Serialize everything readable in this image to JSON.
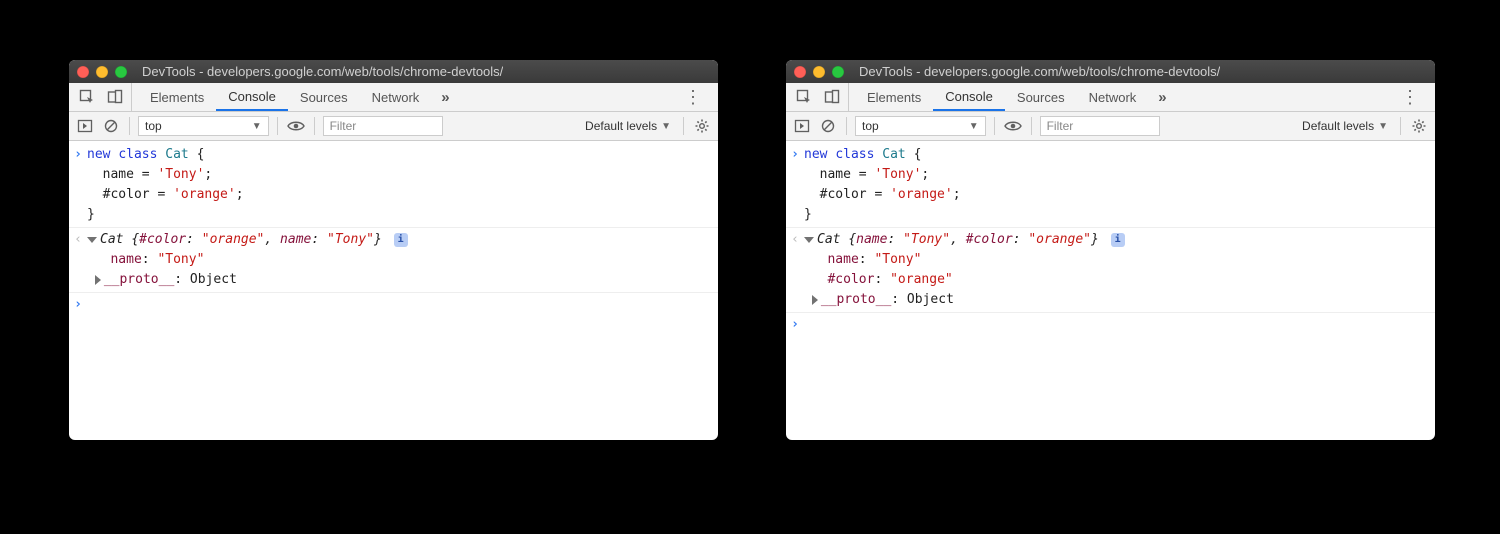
{
  "windows": [
    {
      "title": "DevTools - developers.google.com/web/tools/chrome-devtools/",
      "tabs": [
        "Elements",
        "Console",
        "Sources",
        "Network"
      ],
      "active_tab": "Console",
      "more_tabs_glyph": "»",
      "toolbar": {
        "context": "top",
        "filter_placeholder": "Filter",
        "levels": "Default levels"
      },
      "input_code": "new class Cat {\n  name = 'Tony';\n  #color = 'orange';\n}",
      "result": {
        "header_prefix": "Cat ",
        "header_body": "{#color: \"orange\", name: \"Tony\"}",
        "props": [
          {
            "key": "name",
            "value": "\"Tony\"",
            "is_string": true
          }
        ],
        "proto": {
          "key": "__proto__",
          "value": "Object"
        }
      }
    },
    {
      "title": "DevTools - developers.google.com/web/tools/chrome-devtools/",
      "tabs": [
        "Elements",
        "Console",
        "Sources",
        "Network"
      ],
      "active_tab": "Console",
      "more_tabs_glyph": "»",
      "toolbar": {
        "context": "top",
        "filter_placeholder": "Filter",
        "levels": "Default levels"
      },
      "input_code": "new class Cat {\n  name = 'Tony';\n  #color = 'orange';\n}",
      "result": {
        "header_prefix": "Cat ",
        "header_body": "{name: \"Tony\", #color: \"orange\"}",
        "props": [
          {
            "key": "name",
            "value": "\"Tony\"",
            "is_string": true
          },
          {
            "key": "#color",
            "value": "\"orange\"",
            "is_string": true
          }
        ],
        "proto": {
          "key": "__proto__",
          "value": "Object"
        }
      }
    }
  ]
}
